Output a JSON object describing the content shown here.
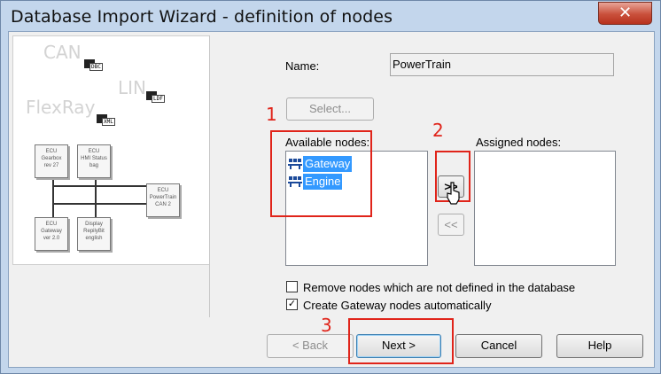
{
  "window": {
    "title": "Database Import Wizard - definition of nodes",
    "close_glyph": "✕"
  },
  "preview": {
    "buses": [
      "CAN",
      "LIN",
      "FlexRay"
    ],
    "file_tags": [
      "DBC",
      "LDF",
      "XML"
    ],
    "ecus": [
      {
        "line1": "ECU",
        "line2": "Gearbox",
        "line3": "rev 27"
      },
      {
        "line1": "ECU",
        "line2": "HMI Status",
        "line3": "bag"
      },
      {
        "line1": "ECU",
        "line2": "Gateway",
        "line3": "ver 2.0"
      },
      {
        "line1": "Display",
        "line2": "RepilyBit",
        "line3": "english"
      },
      {
        "line1": "ECU",
        "line2": "PowerTrain",
        "line3": "CAN 2"
      }
    ]
  },
  "form": {
    "name_label": "Name:",
    "name_value": "PowerTrain",
    "select_button": "Select...",
    "available_label": "Available nodes:",
    "assigned_label": "Assigned nodes:",
    "available_nodes": [
      {
        "label": "Gateway",
        "icon": "network-node-icon"
      },
      {
        "label": "Engine",
        "icon": "network-node-icon"
      }
    ],
    "assigned_nodes": [],
    "add_button": ">>",
    "remove_button": "<<",
    "remove_nodes_label": "Remove nodes which are not defined in the database",
    "remove_nodes_checked": false,
    "create_gateway_label": "Create Gateway nodes automatically",
    "create_gateway_checked": true,
    "check_glyph": "✓"
  },
  "buttons": {
    "back": "< Back",
    "next": "Next >",
    "cancel": "Cancel",
    "help": "Help"
  },
  "annotations": [
    "1",
    "2",
    "3"
  ],
  "colors": {
    "selection": "#3399ff",
    "annotation_red": "#e0241a"
  }
}
